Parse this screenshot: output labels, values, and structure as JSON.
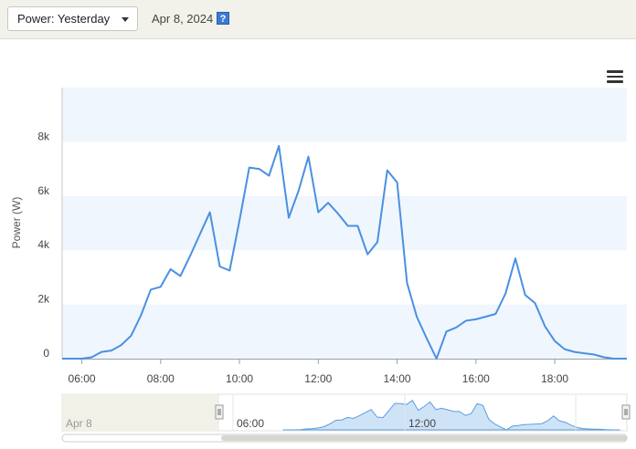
{
  "header": {
    "period_select": "Power: Yesterday",
    "date_label": "Apr 8, 2024",
    "help_glyph": "?"
  },
  "chart_data": {
    "type": "line",
    "ylabel": "Power (W)",
    "y_ticks": [
      "0",
      "2k",
      "4k",
      "6k",
      "8k"
    ],
    "x_ticks": [
      "06:00",
      "08:00",
      "10:00",
      "12:00",
      "14:00",
      "16:00",
      "18:00"
    ],
    "ylim": [
      0,
      10000
    ],
    "xlim": [
      5.5,
      19.83
    ],
    "grid": "alternating horizontal bands",
    "color": "#4a90e2",
    "x": [
      5.5,
      6.0,
      6.25,
      6.5,
      6.75,
      7.0,
      7.25,
      7.5,
      7.75,
      8.0,
      8.25,
      8.5,
      8.75,
      9.0,
      9.25,
      9.5,
      9.75,
      10.0,
      10.25,
      10.5,
      10.75,
      11.0,
      11.25,
      11.5,
      11.75,
      12.0,
      12.25,
      12.5,
      12.75,
      13.0,
      13.25,
      13.5,
      13.75,
      14.0,
      14.25,
      14.5,
      14.75,
      15.0,
      15.25,
      15.5,
      15.75,
      16.0,
      16.25,
      16.5,
      16.75,
      17.0,
      17.25,
      17.5,
      17.75,
      18.0,
      18.25,
      18.5,
      18.75,
      19.0,
      19.25,
      19.5,
      19.75,
      19.83
    ],
    "y": [
      0,
      0,
      50,
      250,
      300,
      500,
      850,
      1600,
      2550,
      2650,
      3300,
      3050,
      3800,
      4600,
      5400,
      3400,
      3250,
      5100,
      7050,
      7000,
      6750,
      7850,
      5200,
      6200,
      7450,
      5400,
      5750,
      5350,
      4900,
      4900,
      3850,
      4300,
      6950,
      6500,
      2800,
      1550,
      750,
      0,
      1000,
      1150,
      1400,
      1450,
      1550,
      1650,
      2400,
      3700,
      2350,
      2050,
      1200,
      650,
      350,
      250,
      200,
      150,
      50,
      0,
      0,
      0
    ]
  },
  "navigator": {
    "date_label": "Apr 8",
    "ticks": [
      "06:00",
      "12:00"
    ],
    "handle_glyph": "|||"
  }
}
